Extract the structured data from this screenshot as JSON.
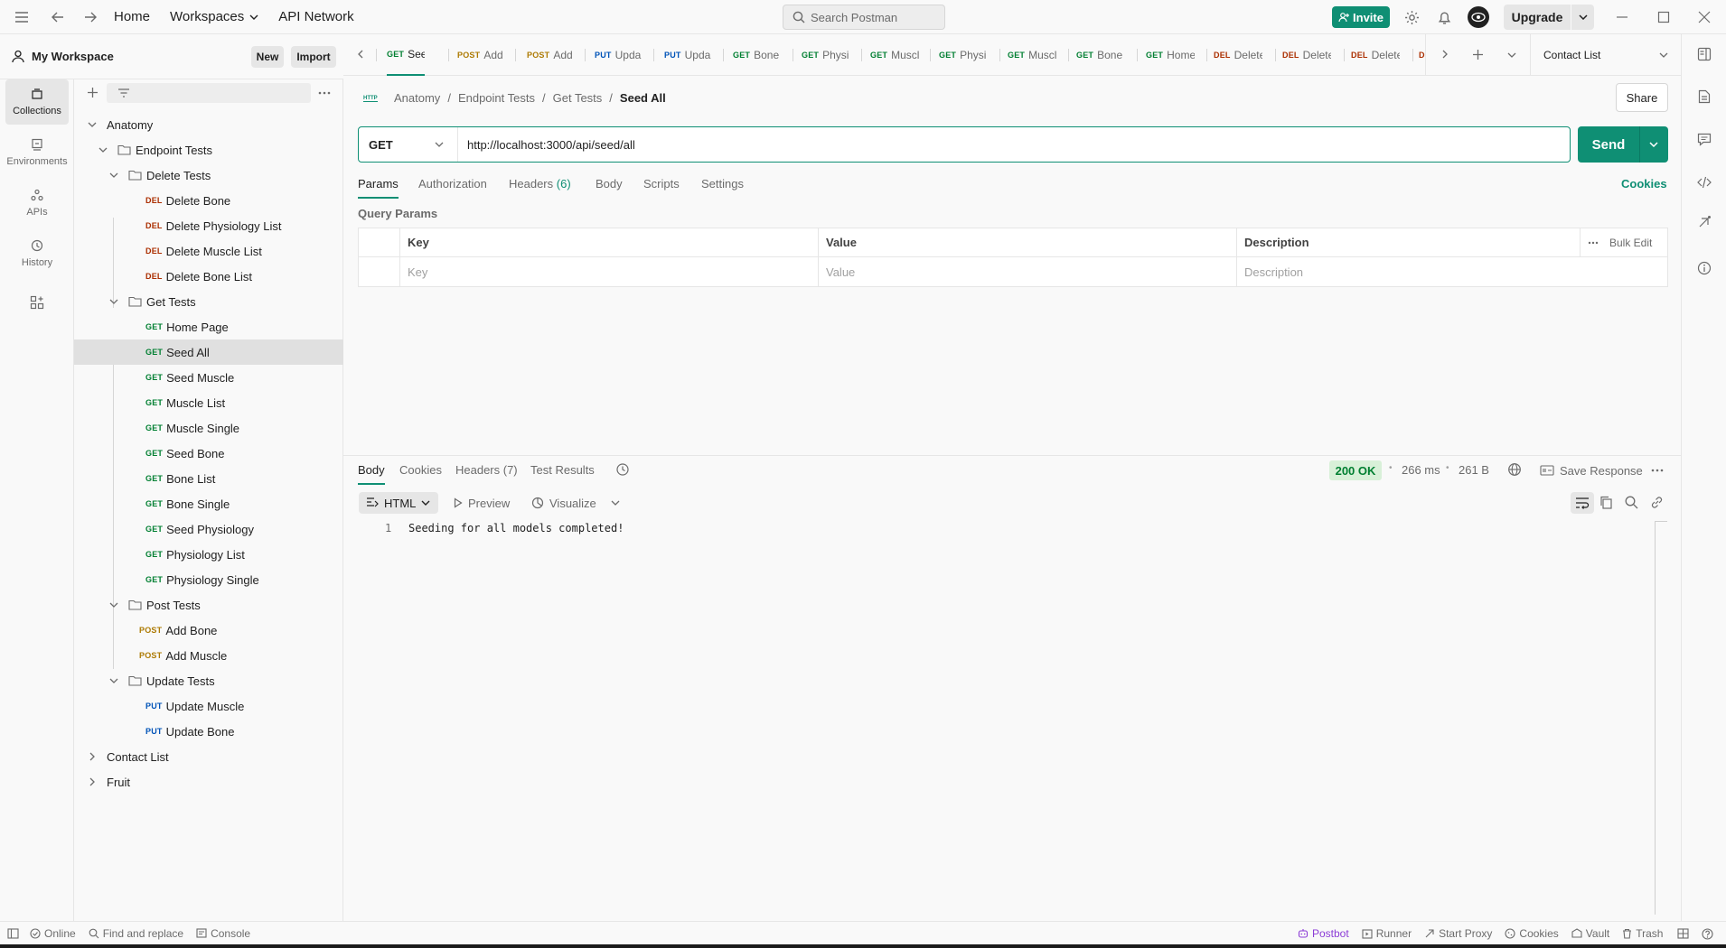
{
  "topbar": {
    "home": "Home",
    "workspaces": "Workspaces",
    "api_network": "API Network",
    "search_placeholder": "Search Postman",
    "invite": "Invite",
    "upgrade": "Upgrade"
  },
  "workspace": {
    "name": "My Workspace",
    "new_label": "New",
    "import_label": "Import"
  },
  "rail": [
    {
      "label": "Collections",
      "icon": "collections-icon"
    },
    {
      "label": "Environments",
      "icon": "environments-icon"
    },
    {
      "label": "APIs",
      "icon": "apis-icon"
    },
    {
      "label": "History",
      "icon": "history-icon"
    }
  ],
  "tree": {
    "anatomy": "Anatomy",
    "endpoint_tests": "Endpoint Tests",
    "delete_tests": "Delete Tests",
    "delete_items": [
      {
        "method": "DEL",
        "label": "Delete Bone"
      },
      {
        "method": "DEL",
        "label": "Delete Physiology List"
      },
      {
        "method": "DEL",
        "label": "Delete Muscle List"
      },
      {
        "method": "DEL",
        "label": "Delete Bone List"
      }
    ],
    "get_tests": "Get Tests",
    "get_items": [
      {
        "method": "GET",
        "label": "Home Page"
      },
      {
        "method": "GET",
        "label": "Seed All"
      },
      {
        "method": "GET",
        "label": "Seed Muscle"
      },
      {
        "method": "GET",
        "label": "Muscle List"
      },
      {
        "method": "GET",
        "label": "Muscle Single"
      },
      {
        "method": "GET",
        "label": "Seed Bone"
      },
      {
        "method": "GET",
        "label": "Bone List"
      },
      {
        "method": "GET",
        "label": "Bone Single"
      },
      {
        "method": "GET",
        "label": "Seed Physiology"
      },
      {
        "method": "GET",
        "label": "Physiology List"
      },
      {
        "method": "GET",
        "label": "Physiology Single"
      }
    ],
    "post_tests": "Post Tests",
    "post_items": [
      {
        "method": "POST",
        "label": "Add Bone"
      },
      {
        "method": "POST",
        "label": "Add Muscle"
      }
    ],
    "update_tests": "Update Tests",
    "update_items": [
      {
        "method": "PUT",
        "label": "Update Muscle"
      },
      {
        "method": "PUT",
        "label": "Update Bone"
      }
    ],
    "contact_list": "Contact List",
    "fruit": "Fruit"
  },
  "tabs": [
    {
      "method": "GET",
      "label": "Seed"
    },
    {
      "method": "POST",
      "label": "Add"
    },
    {
      "method": "POST",
      "label": "Add"
    },
    {
      "method": "PUT",
      "label": "Upda"
    },
    {
      "method": "PUT",
      "label": "Upda"
    },
    {
      "method": "GET",
      "label": "Bone"
    },
    {
      "method": "GET",
      "label": "Physi"
    },
    {
      "method": "GET",
      "label": "Muscl"
    },
    {
      "method": "GET",
      "label": "Physi"
    },
    {
      "method": "GET",
      "label": "Muscl"
    },
    {
      "method": "GET",
      "label": "Bone"
    },
    {
      "method": "GET",
      "label": "Home"
    },
    {
      "method": "DEL",
      "label": "Delete"
    },
    {
      "method": "DEL",
      "label": "Delete"
    },
    {
      "method": "DEL",
      "label": "Delete"
    },
    {
      "method": "D",
      "label": ""
    }
  ],
  "environment": "Contact List",
  "breadcrumb": {
    "c1": "Anatomy",
    "c2": "Endpoint Tests",
    "c3": "Get Tests",
    "current": "Seed All",
    "sep": "/"
  },
  "share": "Share",
  "request": {
    "method": "GET",
    "url": "http://localhost:3000/api/seed/all",
    "send": "Send"
  },
  "req_tabs": {
    "params": "Params",
    "authorization": "Authorization",
    "headers": "Headers",
    "headers_count": "(6)",
    "body": "Body",
    "scripts": "Scripts",
    "settings": "Settings",
    "cookies": "Cookies"
  },
  "query_params": {
    "title": "Query Params",
    "col_key": "Key",
    "col_value": "Value",
    "col_description": "Description",
    "bulk_edit": "Bulk Edit",
    "ph_key": "Key",
    "ph_value": "Value",
    "ph_description": "Description"
  },
  "response": {
    "tabs": {
      "body": "Body",
      "cookies": "Cookies",
      "headers": "Headers (7)",
      "test_results": "Test Results"
    },
    "status": "200 OK",
    "time": "266 ms",
    "size": "261 B",
    "dot": "•",
    "save_response": "Save Response",
    "format": "HTML",
    "preview": "Preview",
    "visualize": "Visualize",
    "line_no": "1",
    "body_text": "Seeding for all models completed!"
  },
  "statusbar": {
    "online": "Online",
    "find_replace": "Find and replace",
    "console": "Console",
    "postbot": "Postbot",
    "runner": "Runner",
    "start_proxy": "Start Proxy",
    "cookies": "Cookies",
    "vault": "Vault",
    "trash": "Trash"
  },
  "colors": {
    "accent": "#0f8f74",
    "get": "#007f31",
    "delete": "#ab2e00",
    "post": "#ad7a03",
    "put": "#0053b8",
    "postbot": "#8b3bd6"
  }
}
